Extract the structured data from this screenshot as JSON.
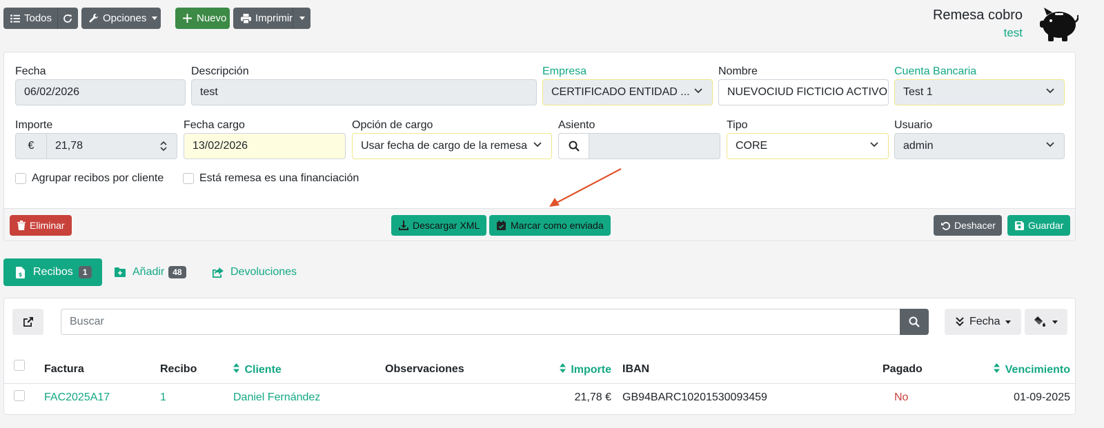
{
  "toolbar": {
    "all_label": "Todos",
    "options_label": "Opciones",
    "new_label": "Nuevo",
    "print_label": "Imprimir"
  },
  "header": {
    "title": "Remesa cobro",
    "subtitle": "test"
  },
  "form": {
    "fecha": {
      "label": "Fecha",
      "value": "06/02/2026"
    },
    "descripcion": {
      "label": "Descripción",
      "value": "test"
    },
    "empresa": {
      "label": "Empresa",
      "value": "CERTIFICADO ENTIDAD ..."
    },
    "nombre": {
      "label": "Nombre",
      "value": "NUEVOCIUD FICTICIO ACTIVO"
    },
    "cuenta": {
      "label": "Cuenta Bancaria",
      "value": "Test 1"
    },
    "importe": {
      "label": "Importe",
      "currency": "€",
      "value": "21,78"
    },
    "fecha_cargo": {
      "label": "Fecha cargo",
      "value": "13/02/2026"
    },
    "opcion_cargo": {
      "label": "Opción de cargo",
      "value": "Usar fecha de cargo de la remesa"
    },
    "asiento": {
      "label": "Asiento",
      "value": ""
    },
    "tipo": {
      "label": "Tipo",
      "value": "CORE"
    },
    "usuario": {
      "label": "Usuario",
      "value": "admin"
    },
    "agrupar_label": "Agrupar recibos por cliente",
    "financiacion_label": "Está remesa es una financiación"
  },
  "actions": {
    "delete_label": "Eliminar",
    "download_xml_label": "Descargar XML",
    "mark_sent_label": "Marcar como enviada",
    "undo_label": "Deshacer",
    "save_label": "Guardar"
  },
  "tabs": [
    {
      "label": "Recibos",
      "count": "1"
    },
    {
      "label": "Añadir",
      "count": "48"
    },
    {
      "label": "Devoluciones"
    }
  ],
  "list": {
    "search_placeholder": "Buscar",
    "sort_label": "Fecha",
    "columns": [
      "Factura",
      "Recibo",
      "Cliente",
      "Observaciones",
      "Importe",
      "IBAN",
      "Pagado",
      "Vencimiento"
    ],
    "rows": [
      {
        "factura": "FAC2025A17",
        "recibo": "1",
        "cliente": "Daniel Fernández",
        "observaciones": "",
        "importe": "21,78 €",
        "iban": "GB94BARC10201530093459",
        "pagado": "No",
        "vencimiento": "01-09-2025"
      }
    ]
  },
  "colors": {
    "accent": "#13a884",
    "danger": "#c8423b",
    "secondary": "#5a6268",
    "success": "#3c8a46",
    "annotation_arrow": "#e0532a"
  }
}
